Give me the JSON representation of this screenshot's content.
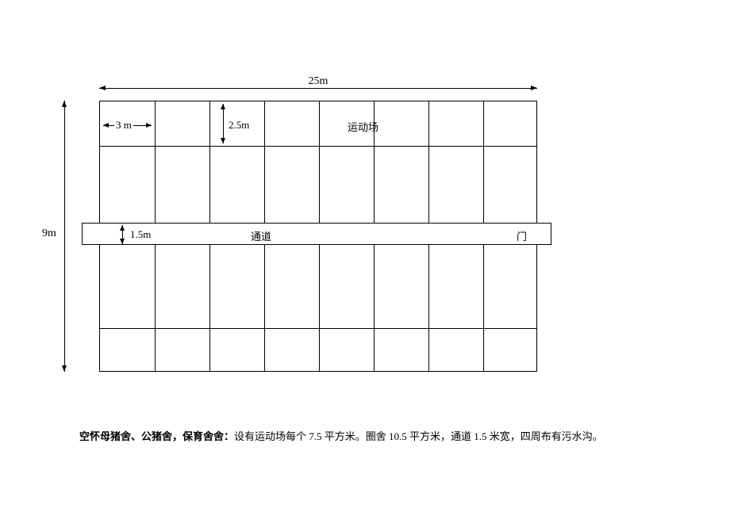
{
  "dims": {
    "width_label": "25m",
    "height_label": "9m",
    "column_width_label": "3 m",
    "yard_depth_label": "2.5m",
    "corridor_width_label": "1.5m"
  },
  "text": {
    "yard": "运动场",
    "corridor": "通道",
    "door": "门"
  },
  "caption": {
    "title": "空怀母猪舍、公猪舍，保育舍舍：",
    "body": "设有运动场每个 7.5 平方米。圈舍 10.5 平方米，通道 1.5 米宽，四周布有污水沟。"
  },
  "chart_data": {
    "type": "table",
    "title": "空怀母猪舍、公猪舍，保育舍舍",
    "building_width_m": 25,
    "building_depth_m": 9,
    "columns": 8,
    "column_width_m": 3,
    "exercise_yard_depth_m": 2.5,
    "corridor_width_m": 1.5,
    "exercise_yard_area_m2": 7.5,
    "pen_area_m2": 10.5,
    "notes": "四周布有污水沟"
  }
}
